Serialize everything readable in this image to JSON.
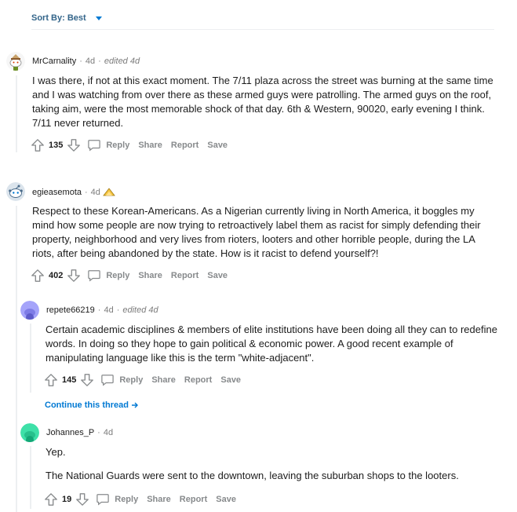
{
  "sort": {
    "label": "Sort By: Best"
  },
  "continue_thread": "Continue this thread",
  "actions": {
    "reply": "Reply",
    "share": "Share",
    "report": "Report",
    "save": "Save"
  },
  "comments": [
    {
      "user": "MrCarnality",
      "age": "4d",
      "edited": "edited 4d",
      "paragraphs": [
        "I was there, if not at this exact moment. The 7/11 plaza across the street was burning at the same time and I was watching from over there as these armed guys were patrolling. The armed guys on the roof, taking aim, were the most memorable shock of that day. 6th & Western, 90020, early evening I think. 7/11 never returned."
      ],
      "score": "135"
    },
    {
      "user": "egieasemota",
      "age": "4d",
      "paragraphs": [
        "Respect to these Korean-Americans. As a Nigerian currently living in North America, it boggles my mind how some people are now trying to retroactively label them as racist for simply defending their property, neighborhood and very lives from rioters, looters and other horrible people, during the LA riots, after being abandoned by the state. How is it racist to defend yourself?!"
      ],
      "score": "402"
    },
    {
      "user": "repete66219",
      "age": "4d",
      "edited": "edited 4d",
      "paragraphs": [
        "Certain academic disciplines & members of elite institutions have been doing all they can to redefine words. In doing so they hope to gain political & economic power. A good recent example of manipulating language like this is the term \"white-adjacent\"."
      ],
      "score": "145"
    },
    {
      "user": "Johannes_P",
      "age": "4d",
      "paragraphs": [
        "Yep.",
        "The National Guards were sent to the downtown, leaving the suburban shops to the looters."
      ],
      "score": "19"
    }
  ]
}
